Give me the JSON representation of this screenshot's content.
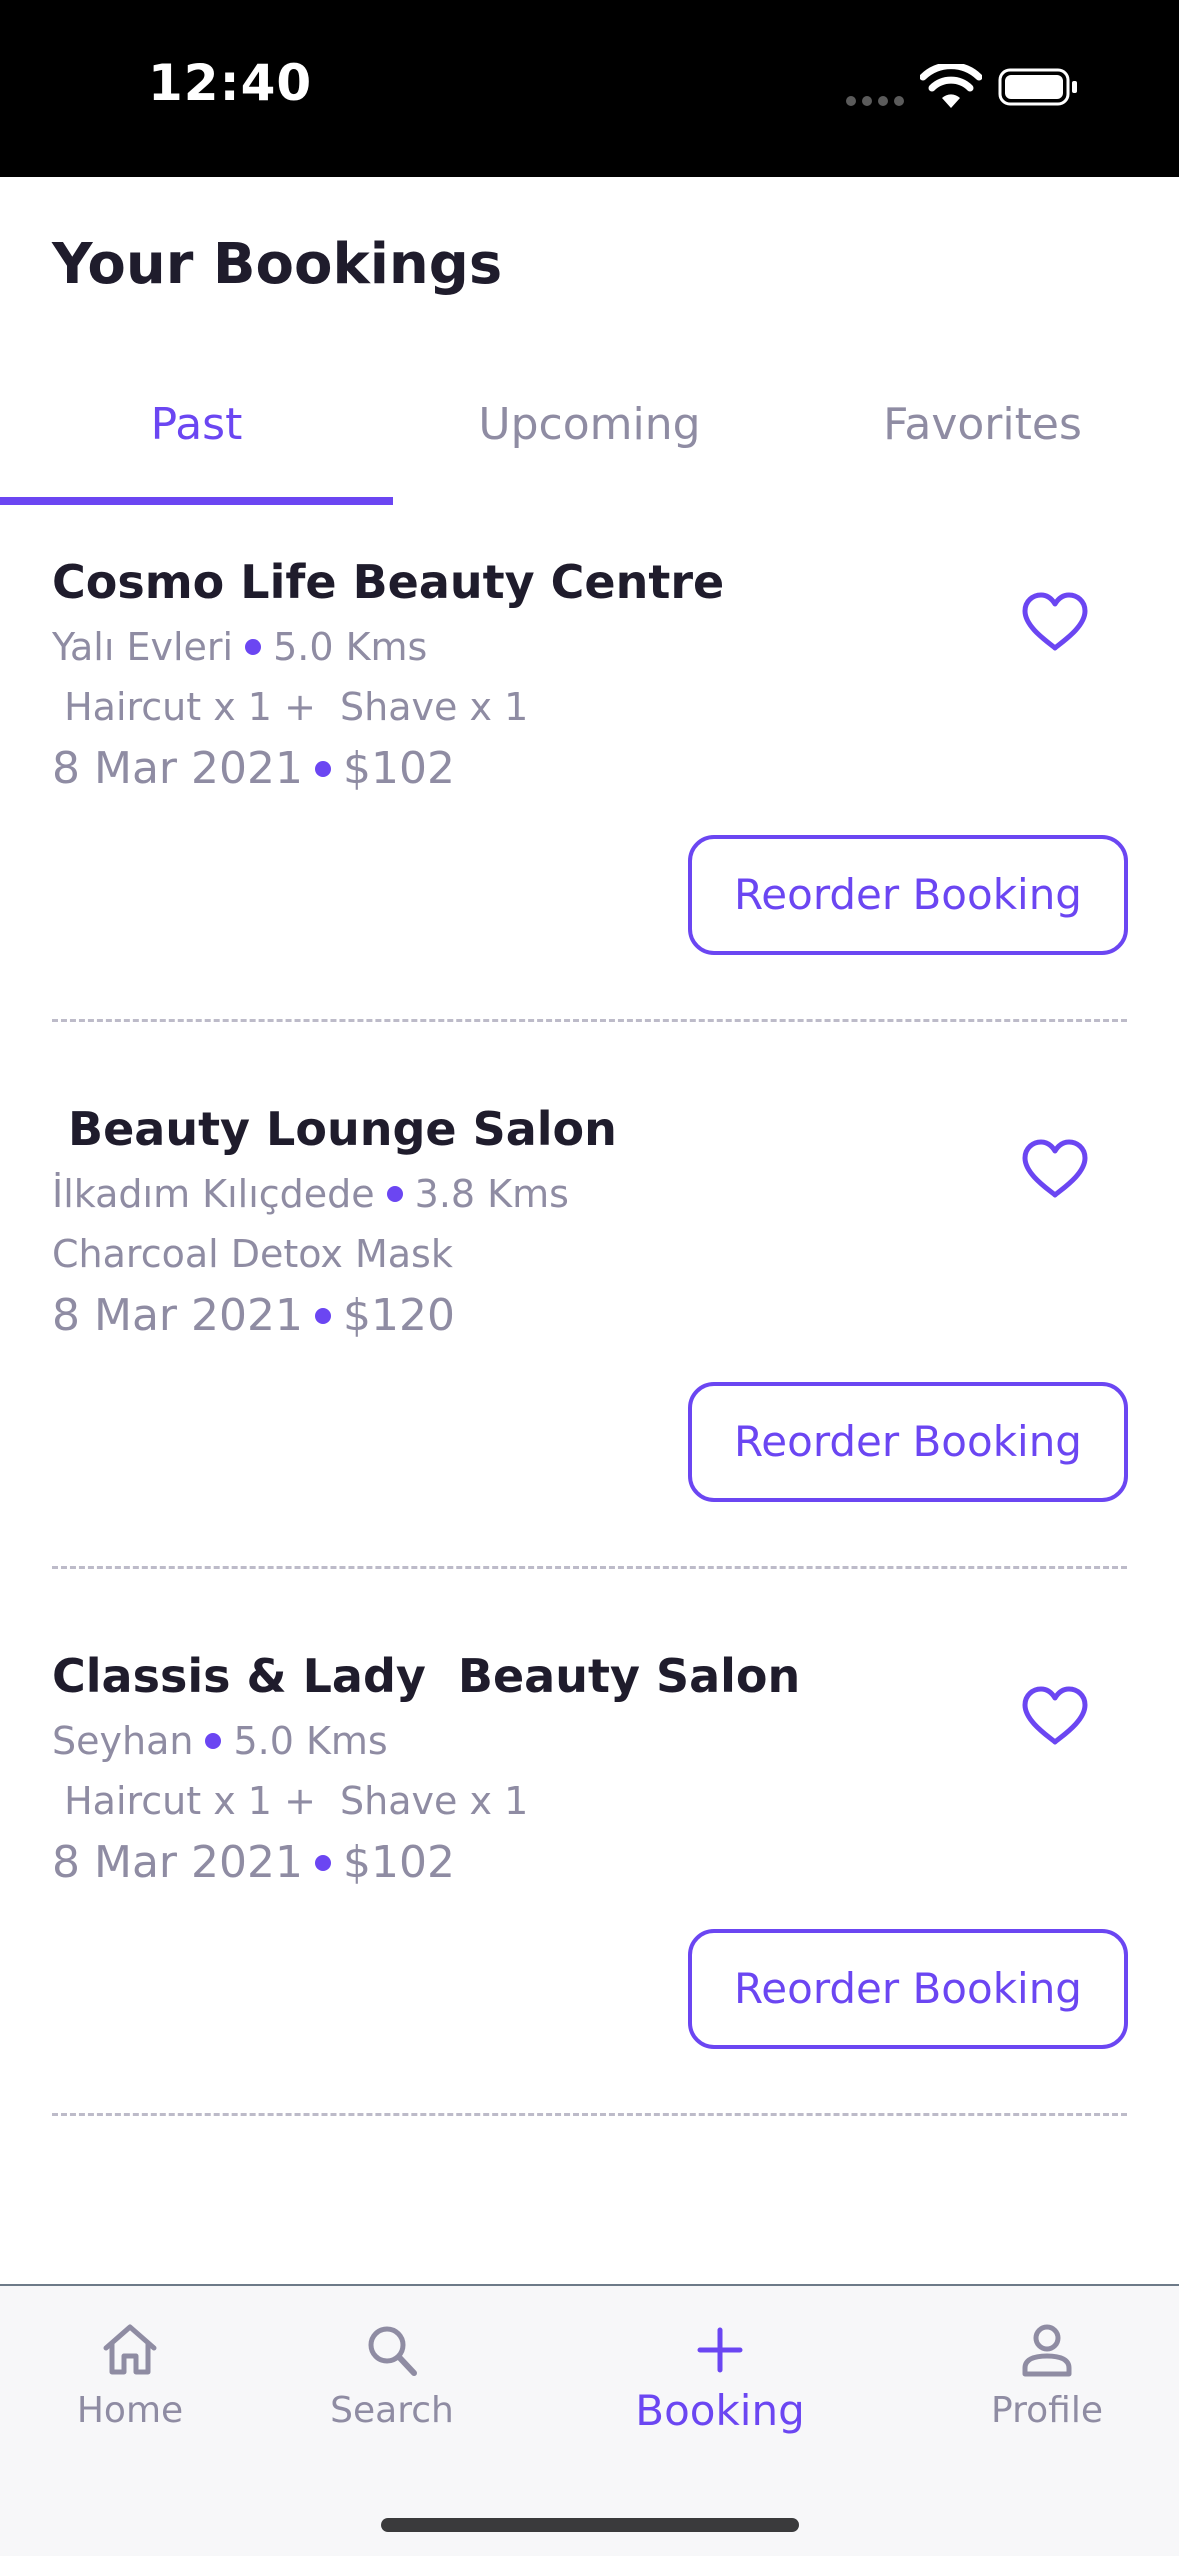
{
  "status_bar": {
    "time": "12:40"
  },
  "header": {
    "title": "Your Bookings"
  },
  "tabs": [
    {
      "label": "Past",
      "active": true
    },
    {
      "label": "Upcoming",
      "active": false
    },
    {
      "label": "Favorites",
      "active": false
    }
  ],
  "bookings": [
    {
      "name": "Cosmo Life Beauty Centre",
      "location": "Yalı Evleri",
      "distance": "5.0 Kms",
      "services": " Haircut x 1 +  Shave x 1",
      "date": "8 Mar 2021",
      "price": "$102",
      "action": "Reorder Booking"
    },
    {
      "name": " Beauty Lounge Salon",
      "location": "İlkadım Kılıçdede",
      "distance": "3.8 Kms",
      "services": "Charcoal Detox Mask",
      "date": "8 Mar 2021",
      "price": "$120",
      "action": "Reorder Booking"
    },
    {
      "name": "Classis & Lady  Beauty Salon",
      "location": "Seyhan",
      "distance": "5.0 Kms",
      "services": " Haircut x 1 +  Shave x 1",
      "date": "8 Mar 2021",
      "price": "$102",
      "action": "Reorder Booking"
    }
  ],
  "bottom_nav": [
    {
      "label": "Home",
      "icon": "home-icon",
      "active": false
    },
    {
      "label": "Search",
      "icon": "search-icon",
      "active": false
    },
    {
      "label": "Booking",
      "icon": "plus-icon",
      "active": true
    },
    {
      "label": "Profile",
      "icon": "person-icon",
      "active": false
    }
  ],
  "colors": {
    "accent": "#6b46f2",
    "muted": "#8f8ca3",
    "text": "#1f1c2c"
  }
}
